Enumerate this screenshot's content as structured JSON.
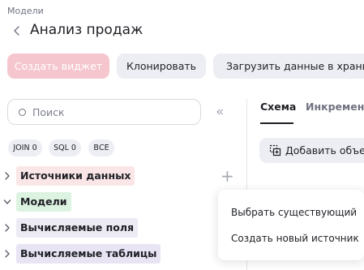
{
  "breadcrumb": "Модели",
  "page_title": "Анализ продаж",
  "toolbar": {
    "create_widget": "Создать виджет",
    "clone": "Клонировать",
    "load_data": "Загрузить данные в хранилище"
  },
  "search": {
    "placeholder": "Поиск",
    "value": ""
  },
  "chips": {
    "join": "JOIN 0",
    "sql": "SQL 0",
    "all": "ВСЕ"
  },
  "tree": {
    "sources": "Источники данных",
    "models": "Модели",
    "calc_fields": "Вычисляемые поля",
    "calc_tables": "Вычисляемые таблицы"
  },
  "tabs": {
    "schema": "Схема",
    "incremental": "Инкременты"
  },
  "add_object": "Добавить объект",
  "menu": {
    "choose_existing": "Выбрать существующий",
    "create_new_source": "Создать новый источник"
  },
  "colors": {
    "primary_disabled": "#f5c6ce",
    "sources_bg": "#fbe6e7",
    "models_bg": "#dcf3e1",
    "calc_fields_bg": "#eceaf2",
    "calc_tables_bg": "#e8e4f4"
  },
  "icons": [
    "back-arrow-icon",
    "search-icon",
    "collapse-panel-icon",
    "chevron-right-icon",
    "chevron-down-icon",
    "plus-icon",
    "add-object-icon"
  ]
}
